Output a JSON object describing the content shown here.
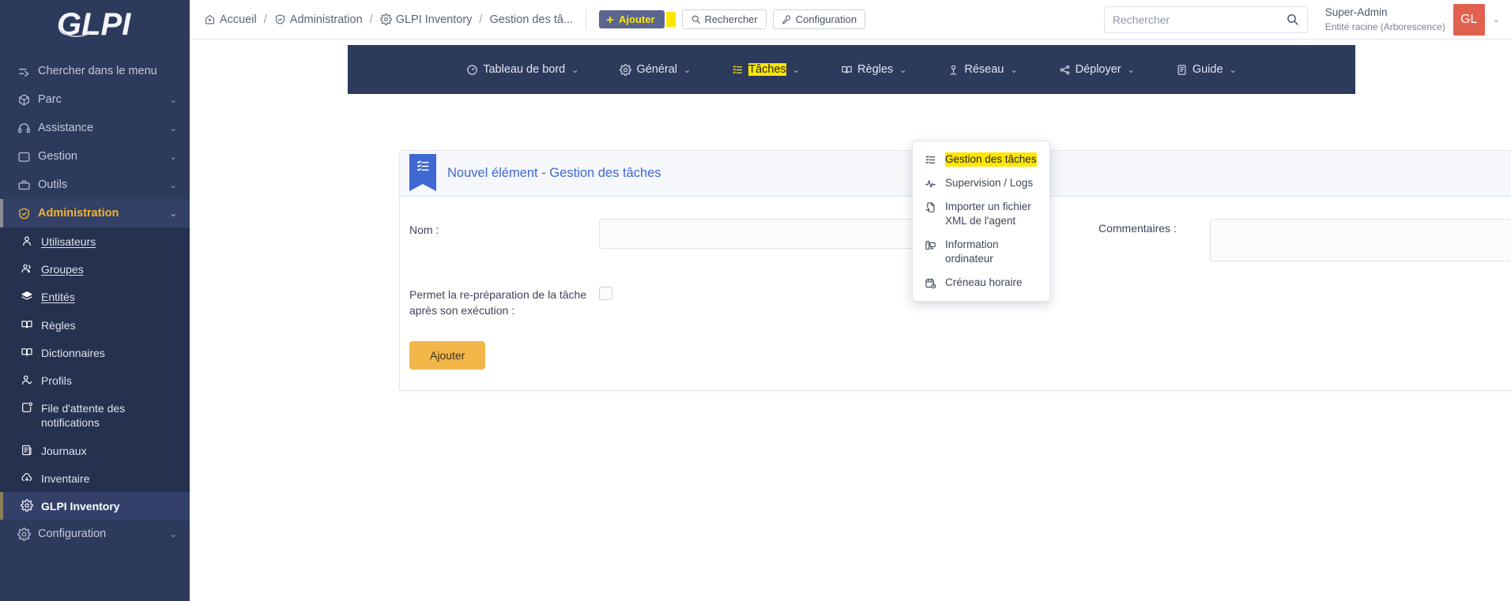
{
  "brand": {
    "logo_text": "GLPI"
  },
  "sidebar": {
    "search_label": "Chercher dans le menu",
    "items": [
      {
        "label": "Parc",
        "icon": "box-icon"
      },
      {
        "label": "Assistance",
        "icon": "headset-icon"
      },
      {
        "label": "Gestion",
        "icon": "wallet-icon"
      },
      {
        "label": "Outils",
        "icon": "briefcase-icon"
      },
      {
        "label": "Administration",
        "icon": "shield-check-icon",
        "active": true
      }
    ],
    "admin_children": [
      {
        "label": "Utilisateurs",
        "accel": "U",
        "icon": "user-icon"
      },
      {
        "label": "Groupes",
        "accel": "G",
        "icon": "users-icon"
      },
      {
        "label": "Entités",
        "accel": "n",
        "icon": "layers-icon"
      },
      {
        "label": "Règles",
        "accel": "",
        "icon": "book-icon"
      },
      {
        "label": "Dictionnaires",
        "accel": "",
        "icon": "book-icon"
      },
      {
        "label": "Profils",
        "accel": "",
        "icon": "user-check-icon"
      },
      {
        "label": "File d'attente des notifications",
        "accel": "",
        "icon": "notification-icon"
      },
      {
        "label": "Journaux",
        "accel": "",
        "icon": "journal-icon"
      },
      {
        "label": "Inventaire",
        "accel": "",
        "icon": "cloud-download-icon"
      },
      {
        "label": "GLPI Inventory",
        "accel": "",
        "icon": "gear-icon",
        "current": true
      }
    ],
    "footer_item": {
      "label": "Configuration",
      "icon": "gear-icon"
    }
  },
  "topbar": {
    "breadcrumb": [
      {
        "label": "Accueil",
        "icon": "home-icon"
      },
      {
        "label": "Administration",
        "icon": "shield-check-icon"
      },
      {
        "label": "GLPI Inventory",
        "icon": "gear-icon"
      },
      {
        "label": "Gestion des tâ...",
        "icon": ""
      }
    ],
    "separator": "/",
    "add_button": "Ajouter",
    "search_button": "Rechercher",
    "config_button": "Configuration",
    "search_placeholder": "Rechercher",
    "search_value": "",
    "user_name": "Super-Admin",
    "user_entity": "Entité racine (Arborescence)",
    "avatar_initials": "GL"
  },
  "modulenav": {
    "items": [
      {
        "label": "Tableau de bord",
        "icon": "dashboard-icon",
        "caret": "⌄"
      },
      {
        "label": "Général",
        "icon": "gear-icon",
        "caret": "⌄"
      },
      {
        "label": "Tâches",
        "icon": "tasklist-icon",
        "caret": "⌄",
        "highlight": true
      },
      {
        "label": "Règles",
        "icon": "book-icon",
        "caret": "⌄"
      },
      {
        "label": "Réseau",
        "icon": "network-icon",
        "caret": "⌄"
      },
      {
        "label": "Déployer",
        "icon": "deploy-icon",
        "caret": "⌄"
      },
      {
        "label": "Guide",
        "icon": "guide-icon",
        "caret": "⌄"
      }
    ]
  },
  "dropdown": {
    "items": [
      {
        "label": "Gestion des tâches",
        "icon": "tasklist-icon",
        "highlight": true
      },
      {
        "label": "Supervision / Logs",
        "icon": "activity-icon"
      },
      {
        "label": "Importer un fichier XML de l'agent",
        "icon": "file-import-icon"
      },
      {
        "label": "Information ordinateur",
        "icon": "computer-icon"
      },
      {
        "label": "Créneau horaire",
        "icon": "calendar-clock-icon"
      }
    ]
  },
  "card": {
    "title": "Nouvel élément - Gestion des tâches",
    "name_label": "Nom :",
    "name_value": "",
    "comment_label": "Commentaires :",
    "comment_value": "",
    "rerun_label": "Permet la re-préparation de la tâche après son exécution :",
    "submit_label": "Ajouter"
  },
  "colors": {
    "sidebar_bg": "#2c3a5c",
    "accent_yellow": "#ffe600",
    "active_orange": "#f2b334",
    "primary_blue": "#3f68d2",
    "avatar_red": "#e0614e"
  }
}
